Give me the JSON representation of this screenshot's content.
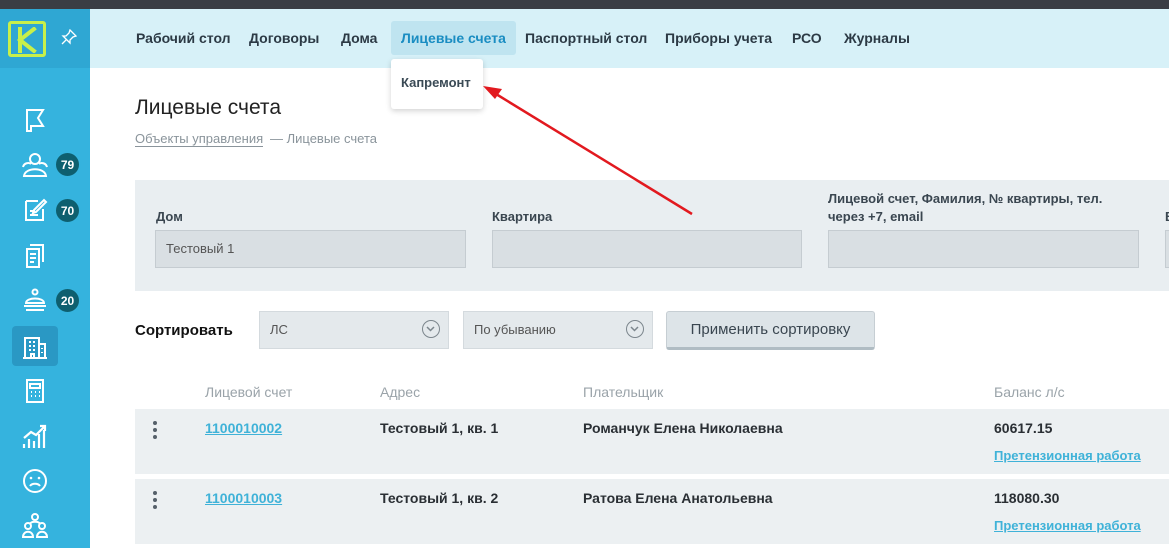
{
  "app": {
    "logo_letter": "K",
    "logo_color": "#c8f04a",
    "accent": "#35b3de"
  },
  "sidebar": {
    "items": [
      {
        "icon": "flag-icon"
      },
      {
        "icon": "people-icon",
        "badge": "79"
      },
      {
        "icon": "edit-document-icon",
        "badge": "70"
      },
      {
        "icon": "documents-icon"
      },
      {
        "icon": "service-bell-icon",
        "badge": "20"
      },
      {
        "icon": "building-icon",
        "active": true
      },
      {
        "icon": "calculator-icon"
      },
      {
        "icon": "chart-icon"
      },
      {
        "icon": "sad-face-icon"
      },
      {
        "icon": "group-icon"
      }
    ]
  },
  "topnav": {
    "items": [
      {
        "label": "Рабочий стол"
      },
      {
        "label": "Договоры"
      },
      {
        "label": "Дома"
      },
      {
        "label": "Лицевые счета",
        "active": true
      },
      {
        "label": "Паспортный стол"
      },
      {
        "label": "Приборы учета"
      },
      {
        "label": "РСО"
      },
      {
        "label": "Журналы"
      }
    ],
    "dropdown": {
      "item": "Капремонт"
    }
  },
  "page": {
    "title": "Лицевые счета",
    "breadcrumb_link": "Объекты управления",
    "breadcrumb_current": "— Лицевые счета"
  },
  "filters": {
    "house_label": "Дом",
    "house_value": "Тестовый 1",
    "apartment_label": "Квартира",
    "apartment_value": "",
    "search_label": "Лицевой счет, Фамилия, № квартиры, тел. через +7, email",
    "search_value": "",
    "cut_label": "В"
  },
  "sort": {
    "label": "Сортировать",
    "field_value": "ЛС",
    "order_value": "По убыванию",
    "apply_label": "Применить сортировку"
  },
  "table": {
    "headers": [
      "Лицевой счет",
      "Адрес",
      "Плательщик",
      "Баланс л/с"
    ],
    "rows": [
      {
        "account": "1100010002",
        "address": "Тестовый 1, кв. 1",
        "payer": "Романчук Елена Николаевна",
        "balance": "60617.15",
        "action": "Претензионная работа"
      },
      {
        "account": "1100010003",
        "address": "Тестовый 1, кв. 2",
        "payer": "Ратова Елена Анатольевна",
        "balance": "118080.30",
        "action": "Претензионная работа"
      }
    ]
  }
}
